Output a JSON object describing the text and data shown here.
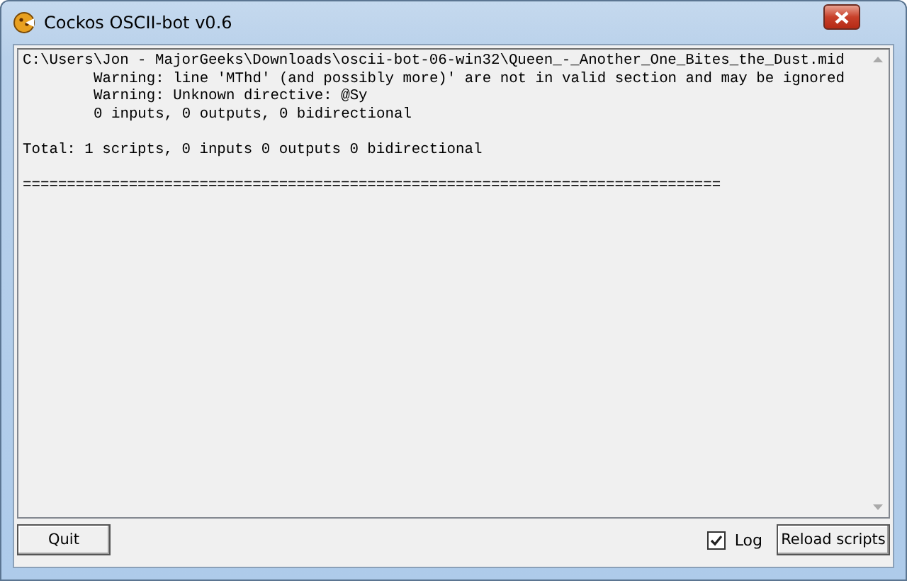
{
  "window": {
    "title": "Cockos OSCII-bot v0.6"
  },
  "log": [
    {
      "text": "C:\\Users\\Jon - MajorGeeks\\Downloads\\oscii-bot-06-win32\\Queen_-_Another_One_Bites_the_Dust.mid",
      "indented": false,
      "space_before": false
    },
    {
      "text": "Warning: line 'MThd' (and possibly more)' are not in valid section and may be ignored",
      "indented": true,
      "space_before": false
    },
    {
      "text": "Warning: Unknown directive: @Sy",
      "indented": true,
      "space_before": false
    },
    {
      "text": "0 inputs, 0 outputs, 0 bidirectional",
      "indented": true,
      "space_before": false
    },
    {
      "text": "Total: 1 scripts, 0 inputs 0 outputs 0 bidirectional",
      "indented": false,
      "space_before": true
    },
    {
      "text": "===============================================================================",
      "indented": false,
      "space_before": true
    }
  ],
  "quit_button": "Quit",
  "log_checkbox": {
    "label": "Log",
    "checked": true
  },
  "reload_button": "Reload scripts"
}
